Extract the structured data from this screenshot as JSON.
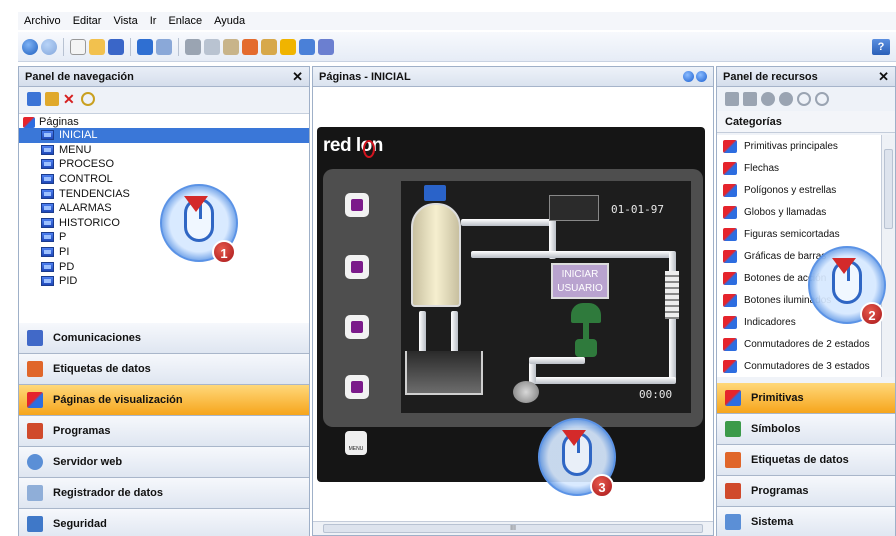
{
  "menubar": {
    "items": [
      "Archivo",
      "Editar",
      "Vista",
      "Ir",
      "Enlace",
      "Ayuda"
    ]
  },
  "left_panel": {
    "title": "Panel de navegación",
    "tree_root": "Páginas",
    "pages": [
      "INICIAL",
      "MENU",
      "PROCESO",
      "CONTROL",
      "TENDENCIAS",
      "ALARMAS",
      "HISTORICO",
      "P",
      "PI",
      "PD",
      "PID"
    ],
    "selected_page": "INICIAL",
    "sections": [
      "Comunicaciones",
      "Etiquetas de datos",
      "Páginas de visualización",
      "Programas",
      "Servidor web",
      "Registrador de datos",
      "Seguridad"
    ],
    "active_section": "Páginas de visualización"
  },
  "center_panel": {
    "title": "Páginas - INICIAL",
    "hmi": {
      "logo_text_1": "red l",
      "logo_text_2": "o",
      "logo_text_3": "n",
      "date": "01-01-97",
      "start_button": "INICIAR\nUSUARIO",
      "time": "00:00",
      "menu_label": "MENU"
    },
    "scroll_label": "III"
  },
  "right_panel": {
    "title": "Panel de recursos",
    "categories_header": "Categorías",
    "categories": [
      "Primitivas principales",
      "Flechas",
      "Polígonos y estrellas",
      "Globos y llamadas",
      "Figuras semicortadas",
      "Gráficas de barras",
      "Botones de acción",
      "Botones iluminados",
      "Indicadores",
      "Conmutadores de 2 estados",
      "Conmutadores de 3 estados"
    ],
    "sections": [
      "Primitivas",
      "Símbolos",
      "Etiquetas de datos",
      "Programas",
      "Sistema"
    ],
    "active_section": "Primitivas"
  },
  "callouts": [
    "1",
    "2",
    "3"
  ],
  "colors": {
    "accent_active": "#f6a51c",
    "selection": "#3a77d8",
    "callout_badge": "#c0261f"
  }
}
